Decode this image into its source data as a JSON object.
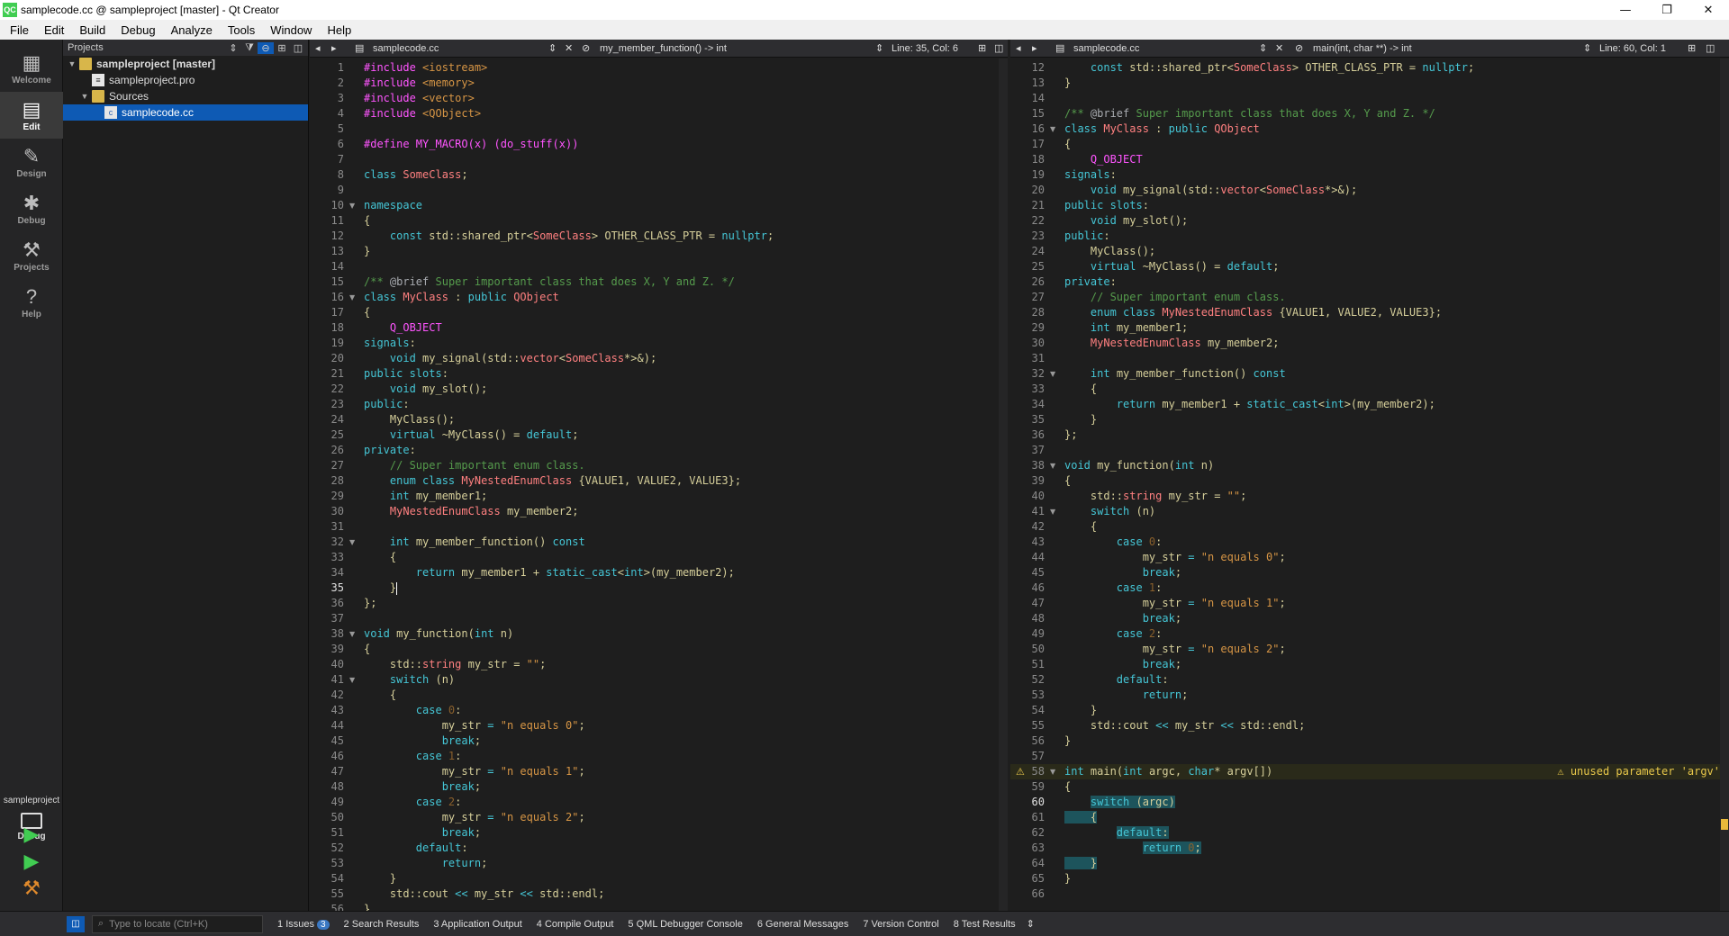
{
  "window": {
    "title": "samplecode.cc @ sampleproject [master] - Qt Creator",
    "app_icon": "QC",
    "minimize": "—",
    "maximize": "❐",
    "close": "✕"
  },
  "menu": [
    "File",
    "Edit",
    "Build",
    "Debug",
    "Analyze",
    "Tools",
    "Window",
    "Help"
  ],
  "modes": [
    {
      "label": "Welcome",
      "icon": "grid-icon",
      "glyph": "▦"
    },
    {
      "label": "Edit",
      "icon": "edit-icon",
      "glyph": "▤"
    },
    {
      "label": "Design",
      "icon": "pencil-icon",
      "glyph": "✎"
    },
    {
      "label": "Debug",
      "icon": "bug-icon",
      "glyph": "✱"
    },
    {
      "label": "Projects",
      "icon": "wrench-icon",
      "glyph": "⚒"
    },
    {
      "label": "Help",
      "icon": "help-icon",
      "glyph": "?"
    }
  ],
  "kit": {
    "project": "sampleproject",
    "mode": "Debug"
  },
  "colors": {
    "accent": "#0e5ab4",
    "run": "#41cd52",
    "warning": "#e8c84a"
  },
  "projects_panel": {
    "title": "Projects",
    "tree": [
      {
        "label": "sampleproject [master]",
        "kind": "project",
        "depth": 0,
        "expanded": true
      },
      {
        "label": "sampleproject.pro",
        "kind": "pro-file",
        "depth": 1
      },
      {
        "label": "Sources",
        "kind": "folder",
        "depth": 1,
        "expanded": true
      },
      {
        "label": "samplecode.cc",
        "kind": "cc-file",
        "depth": 2,
        "selected": true
      }
    ]
  },
  "editors": [
    {
      "file": "samplecode.cc",
      "symbol": "my_member_function() -> int",
      "position": "Line: 35, Col: 6",
      "first_line": 1,
      "current_line": 35,
      "folds": [
        10,
        16,
        32,
        38,
        41
      ]
    },
    {
      "file": "samplecode.cc",
      "symbol": "main(int, char **) -> int",
      "position": "Line: 60, Col: 1",
      "first_line": 12,
      "current_line": 60,
      "folds": [
        16,
        32,
        38,
        41,
        58
      ],
      "warning": {
        "line": 58,
        "message": "unused parameter 'argv'"
      }
    }
  ],
  "source": [
    [
      [
        "pp",
        "#include "
      ],
      [
        "st",
        "<iostream>"
      ]
    ],
    [
      [
        "pp",
        "#include "
      ],
      [
        "st",
        "<memory>"
      ]
    ],
    [
      [
        "pp",
        "#include "
      ],
      [
        "st",
        "<vector>"
      ]
    ],
    [
      [
        "pp",
        "#include "
      ],
      [
        "st",
        "<QObject>"
      ]
    ],
    [],
    [
      [
        "pp",
        "#define "
      ],
      [
        "mac",
        "MY_MACRO"
      ],
      [
        "pp",
        "(x) (do_stuff(x))"
      ]
    ],
    [],
    [
      [
        "kw",
        "class "
      ],
      [
        "ty",
        "SomeClass"
      ],
      [
        "pu",
        ";"
      ]
    ],
    [],
    [
      [
        "kw",
        "namespace"
      ]
    ],
    [
      [
        "pu",
        "{"
      ]
    ],
    [
      [
        "pu",
        "    "
      ],
      [
        "kw",
        "const "
      ],
      [
        "pu",
        "std::shared_ptr<"
      ],
      [
        "ty",
        "SomeClass"
      ],
      [
        "pu",
        "> OTHER_CLASS_PTR = "
      ],
      [
        "kw",
        "nullptr"
      ],
      [
        "pu",
        ";"
      ]
    ],
    [
      [
        "pu",
        "}"
      ]
    ],
    [],
    [
      [
        "dc",
        "/** "
      ],
      [
        "cm",
        "@brief"
      ],
      [
        "dc",
        " Super important class that does X, Y and Z. */"
      ]
    ],
    [
      [
        "kw",
        "class "
      ],
      [
        "ty",
        "MyClass"
      ],
      [
        "pu",
        " : "
      ],
      [
        "kw",
        "public "
      ],
      [
        "ty",
        "QObject"
      ]
    ],
    [
      [
        "pu",
        "{"
      ]
    ],
    [
      [
        "pu",
        "    "
      ],
      [
        "mac",
        "Q_OBJECT"
      ]
    ],
    [
      [
        "kw",
        "signals"
      ],
      [
        "pu",
        ":"
      ]
    ],
    [
      [
        "pu",
        "    "
      ],
      [
        "kw",
        "void "
      ],
      [
        "fn",
        "my_signal"
      ],
      [
        "pu",
        "(std::"
      ],
      [
        "ty",
        "vector"
      ],
      [
        "pu",
        "<"
      ],
      [
        "ty",
        "SomeClass"
      ],
      [
        "pu",
        "*>&);"
      ]
    ],
    [
      [
        "kw",
        "public slots"
      ],
      [
        "pu",
        ":"
      ]
    ],
    [
      [
        "pu",
        "    "
      ],
      [
        "kw",
        "void "
      ],
      [
        "fn",
        "my_slot"
      ],
      [
        "pu",
        "();"
      ]
    ],
    [
      [
        "kw",
        "public"
      ],
      [
        "pu",
        ":"
      ]
    ],
    [
      [
        "pu",
        "    "
      ],
      [
        "fn",
        "MyClass"
      ],
      [
        "pu",
        "();"
      ]
    ],
    [
      [
        "pu",
        "    "
      ],
      [
        "kw",
        "virtual "
      ],
      [
        "fn",
        "~MyClass"
      ],
      [
        "pu",
        "() = "
      ],
      [
        "kw",
        "default"
      ],
      [
        "pu",
        ";"
      ]
    ],
    [
      [
        "kw",
        "private"
      ],
      [
        "pu",
        ":"
      ]
    ],
    [
      [
        "pu",
        "    "
      ],
      [
        "dc",
        "// Super important enum class."
      ]
    ],
    [
      [
        "pu",
        "    "
      ],
      [
        "kw",
        "enum class "
      ],
      [
        "ty",
        "MyNestedEnumClass"
      ],
      [
        "pu",
        " {VALUE1, VALUE2, VALUE3};"
      ]
    ],
    [
      [
        "pu",
        "    "
      ],
      [
        "kw",
        "int "
      ],
      [
        "pu",
        "my_member1;"
      ]
    ],
    [
      [
        "pu",
        "    "
      ],
      [
        "ty",
        "MyNestedEnumClass"
      ],
      [
        "pu",
        " my_member2;"
      ]
    ],
    [],
    [
      [
        "pu",
        "    "
      ],
      [
        "kw",
        "int "
      ],
      [
        "fn",
        "my_member_function"
      ],
      [
        "pu",
        "() "
      ],
      [
        "kw",
        "const"
      ]
    ],
    [
      [
        "pu",
        "    {"
      ]
    ],
    [
      [
        "pu",
        "        "
      ],
      [
        "kw",
        "return "
      ],
      [
        "pu",
        "my_member1 + "
      ],
      [
        "kw",
        "static_cast"
      ],
      [
        "pu",
        "<"
      ],
      [
        "kw",
        "int"
      ],
      [
        "pu",
        ">(my_member2);"
      ]
    ],
    [
      [
        "pu",
        "    }"
      ]
    ],
    [
      [
        "pu",
        "};"
      ]
    ],
    [],
    [
      [
        "kw",
        "void "
      ],
      [
        "fn",
        "my_function"
      ],
      [
        "pu",
        "("
      ],
      [
        "kw",
        "int "
      ],
      [
        "pu",
        "n)"
      ]
    ],
    [
      [
        "pu",
        "{"
      ]
    ],
    [
      [
        "pu",
        "    std::"
      ],
      [
        "ty",
        "string"
      ],
      [
        "pu",
        " my_str = "
      ],
      [
        "st",
        "\"\""
      ],
      [
        "pu",
        ";"
      ]
    ],
    [
      [
        "pu",
        "    "
      ],
      [
        "kw",
        "switch "
      ],
      [
        "pu",
        "(n)"
      ]
    ],
    [
      [
        "pu",
        "    {"
      ]
    ],
    [
      [
        "pu",
        "        "
      ],
      [
        "kw",
        "case "
      ],
      [
        "nu",
        "0"
      ],
      [
        "pu",
        ":"
      ]
    ],
    [
      [
        "pu",
        "            my_str "
      ],
      [
        "kw",
        "="
      ],
      [
        "st",
        " \"n equals 0\""
      ],
      [
        "pu",
        ";"
      ]
    ],
    [
      [
        "pu",
        "            "
      ],
      [
        "kw",
        "break"
      ],
      [
        "pu",
        ";"
      ]
    ],
    [
      [
        "pu",
        "        "
      ],
      [
        "kw",
        "case "
      ],
      [
        "nu",
        "1"
      ],
      [
        "pu",
        ":"
      ]
    ],
    [
      [
        "pu",
        "            my_str "
      ],
      [
        "kw",
        "="
      ],
      [
        "st",
        " \"n equals 1\""
      ],
      [
        "pu",
        ";"
      ]
    ],
    [
      [
        "pu",
        "            "
      ],
      [
        "kw",
        "break"
      ],
      [
        "pu",
        ";"
      ]
    ],
    [
      [
        "pu",
        "        "
      ],
      [
        "kw",
        "case "
      ],
      [
        "nu",
        "2"
      ],
      [
        "pu",
        ":"
      ]
    ],
    [
      [
        "pu",
        "            my_str "
      ],
      [
        "kw",
        "="
      ],
      [
        "st",
        " \"n equals 2\""
      ],
      [
        "pu",
        ";"
      ]
    ],
    [
      [
        "pu",
        "            "
      ],
      [
        "kw",
        "break"
      ],
      [
        "pu",
        ";"
      ]
    ],
    [
      [
        "pu",
        "        "
      ],
      [
        "kw",
        "default"
      ],
      [
        "pu",
        ":"
      ]
    ],
    [
      [
        "pu",
        "            "
      ],
      [
        "kw",
        "return"
      ],
      [
        "pu",
        ";"
      ]
    ],
    [
      [
        "pu",
        "    }"
      ]
    ],
    [
      [
        "pu",
        "    std::cout "
      ],
      [
        "kw",
        "<<"
      ],
      [
        "pu",
        " my_str "
      ],
      [
        "kw",
        "<<"
      ],
      [
        "pu",
        " std::endl;"
      ]
    ],
    [
      [
        "pu",
        "}"
      ]
    ],
    [],
    [
      [
        "kw",
        "int "
      ],
      [
        "fn",
        "main"
      ],
      [
        "pu",
        "("
      ],
      [
        "kw",
        "int "
      ],
      [
        "pu",
        "argc, "
      ],
      [
        "kw",
        "char"
      ],
      [
        "pu",
        "* argv[])"
      ]
    ],
    [
      [
        "pu",
        "{"
      ]
    ],
    [
      [
        "pu",
        "    "
      ],
      [
        "kw",
        "switch "
      ],
      [
        "pu",
        "(argc)"
      ]
    ],
    [
      [
        "pu",
        "    {"
      ]
    ],
    [
      [
        "pu",
        "        "
      ],
      [
        "kw",
        "default"
      ],
      [
        "pu",
        ":"
      ]
    ],
    [
      [
        "pu",
        "            "
      ],
      [
        "kw",
        "return "
      ],
      [
        "nu",
        "0"
      ],
      [
        "pu",
        ";"
      ]
    ],
    [
      [
        "pu",
        "    }"
      ]
    ],
    [
      [
        "pu",
        "}"
      ]
    ],
    []
  ],
  "statusbar": {
    "locate_placeholder": "Type to locate (Ctrl+K)",
    "panes": [
      {
        "num": "1",
        "label": "Issues",
        "badge": "3"
      },
      {
        "num": "2",
        "label": "Search Results"
      },
      {
        "num": "3",
        "label": "Application Output"
      },
      {
        "num": "4",
        "label": "Compile Output"
      },
      {
        "num": "5",
        "label": "QML Debugger Console"
      },
      {
        "num": "6",
        "label": "General Messages"
      },
      {
        "num": "7",
        "label": "Version Control"
      },
      {
        "num": "8",
        "label": "Test Results"
      }
    ]
  }
}
